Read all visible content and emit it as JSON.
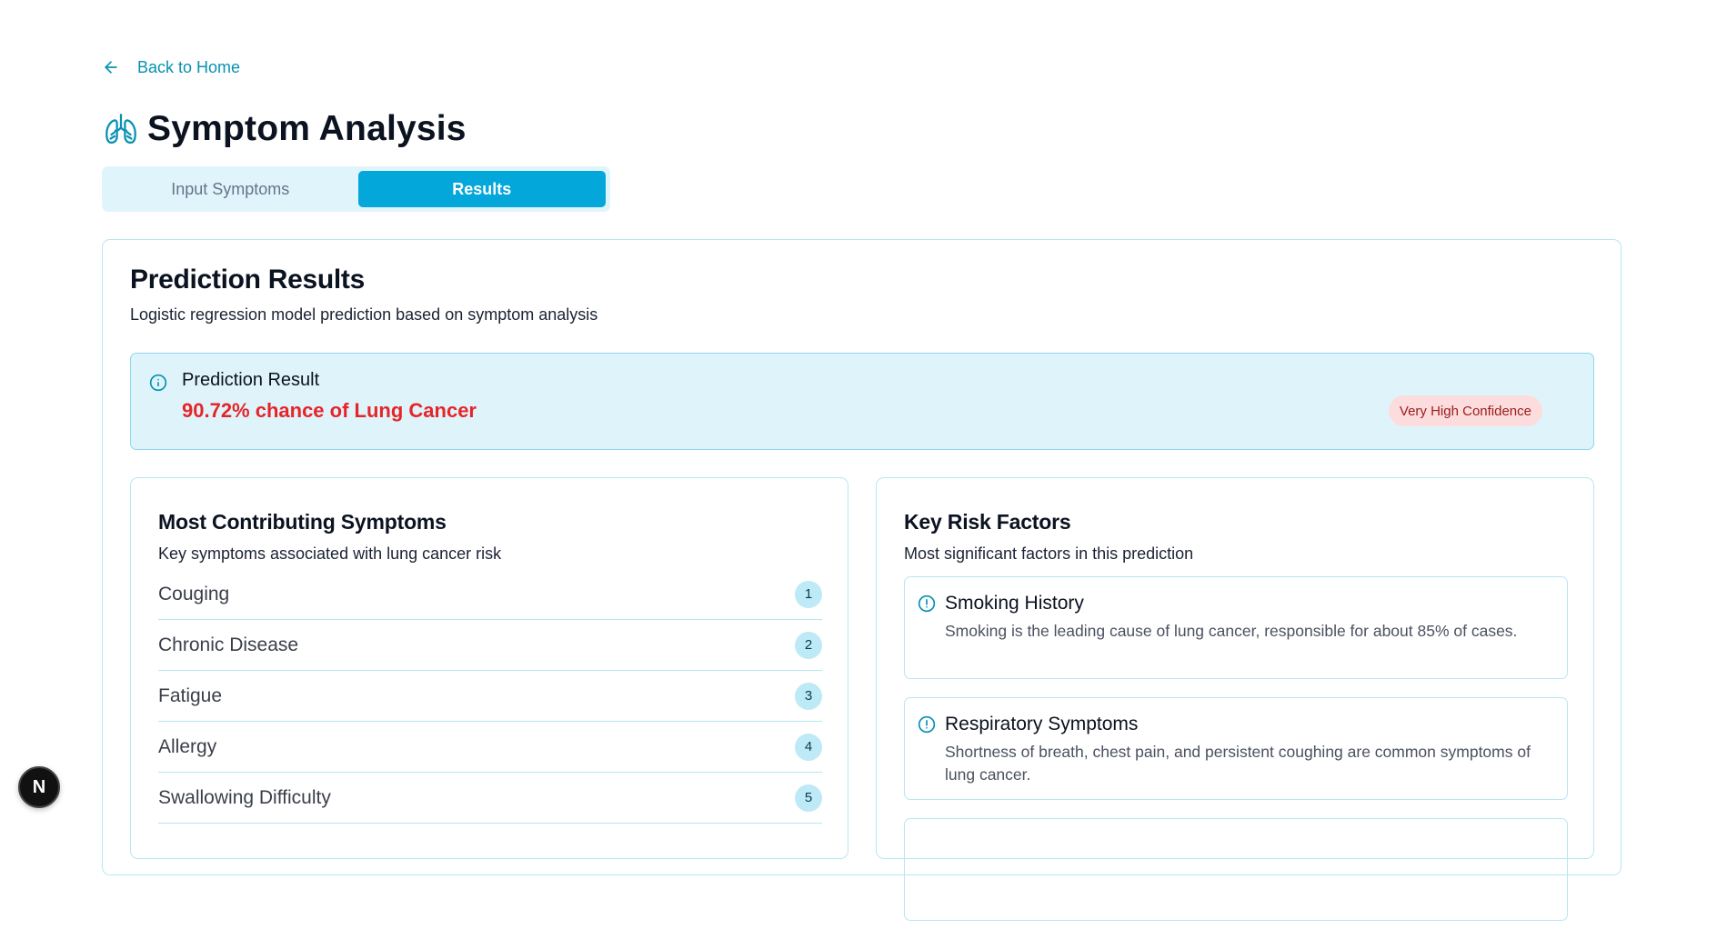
{
  "nav": {
    "back_label": "Back to Home"
  },
  "page": {
    "title": "Symptom Analysis"
  },
  "tabs": [
    {
      "label": "Input Symptoms",
      "active": false
    },
    {
      "label": "Results",
      "active": true
    }
  ],
  "results": {
    "title": "Prediction Results",
    "subtitle": "Logistic regression model prediction based on symptom analysis",
    "alert": {
      "title": "Prediction Result",
      "value": "90.72% chance of Lung Cancer",
      "badge": "Very High Confidence"
    }
  },
  "symptoms": {
    "title": "Most Contributing Symptoms",
    "description": "Key symptoms associated with lung cancer risk",
    "items": [
      {
        "name": "Couging",
        "rank": "1"
      },
      {
        "name": "Chronic Disease",
        "rank": "2"
      },
      {
        "name": "Fatigue",
        "rank": "3"
      },
      {
        "name": "Allergy",
        "rank": "4"
      },
      {
        "name": "Swallowing Difficulty",
        "rank": "5"
      }
    ]
  },
  "risk_factors": {
    "title": "Key Risk Factors",
    "description": "Most significant factors in this prediction",
    "items": [
      {
        "title": "Smoking History",
        "text": "Smoking is the leading cause of lung cancer, responsible for about 85% of cases."
      },
      {
        "title": "Respiratory Symptoms",
        "text": "Shortness of breath, chest pain, and persistent coughing are common symptoms of lung cancer."
      }
    ]
  },
  "dev_badge": {
    "letter": "N"
  },
  "colors": {
    "accent": "#03a7da",
    "link": "#0891b2",
    "danger": "#e5252a",
    "alert_bg": "#dff4fa",
    "badge_bg": "#fcdcdc"
  }
}
